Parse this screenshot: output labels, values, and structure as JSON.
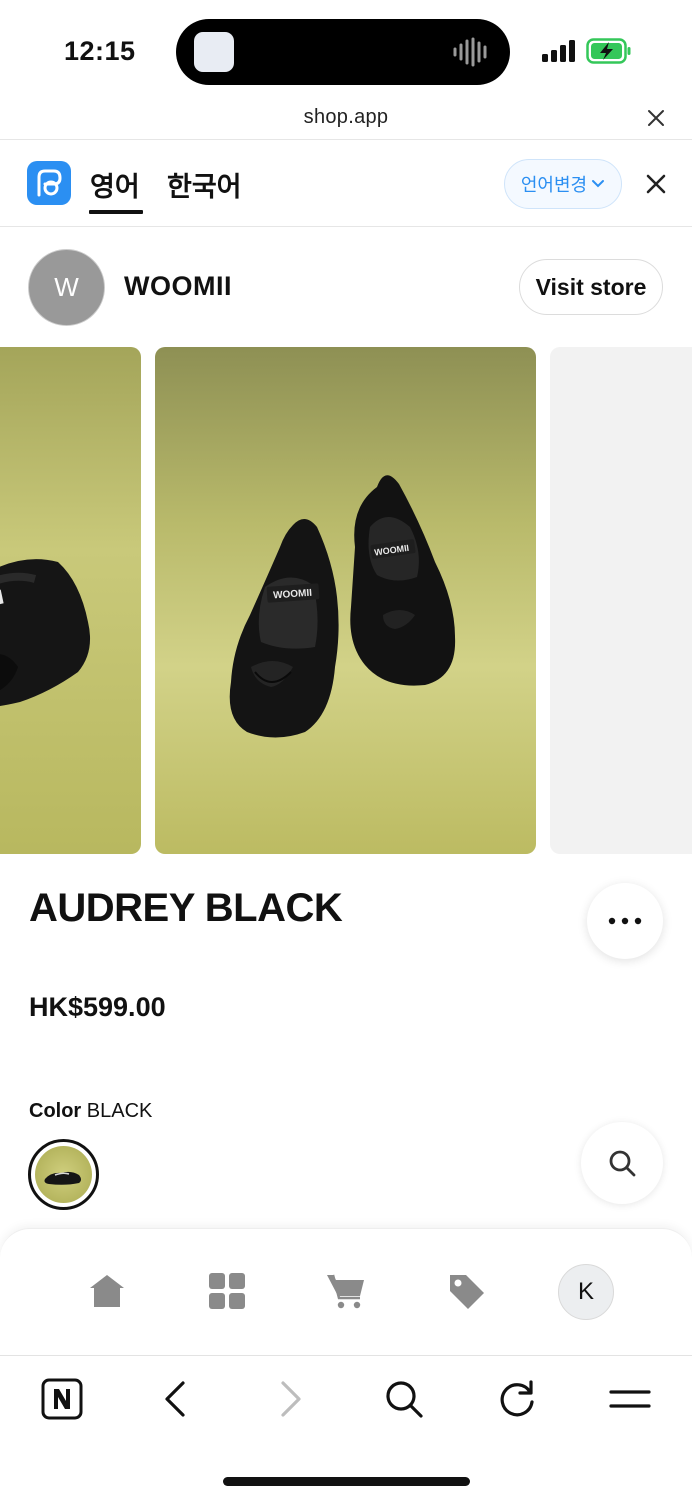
{
  "status_bar": {
    "time": "12:15"
  },
  "url_bar": {
    "url": "shop.app"
  },
  "translate_bar": {
    "tabs": [
      "영어",
      "한국어"
    ],
    "active_tab": "영어",
    "change_language_label": "언어변경"
  },
  "store": {
    "avatar_initial": "W",
    "name": "WOOMII",
    "visit_label": "Visit store"
  },
  "product": {
    "title": "AUDREY BLACK",
    "price": "HK$599.00",
    "color_label": "Color",
    "color_value": "BLACK",
    "shoe_brand_text": "WOOMII"
  },
  "shop_nav": {
    "items": [
      "home-icon",
      "categories-icon",
      "cart-icon",
      "tag-icon"
    ],
    "profile_initial": "K"
  },
  "browser_bar": {
    "items": [
      "naver-icon",
      "back-icon",
      "forward-icon",
      "search-icon",
      "reload-icon",
      "menu-icon"
    ]
  },
  "colors": {
    "accent": "#2b8ff2",
    "product_background": "#c8c87a",
    "icon_gray": "#8a8a8a"
  }
}
